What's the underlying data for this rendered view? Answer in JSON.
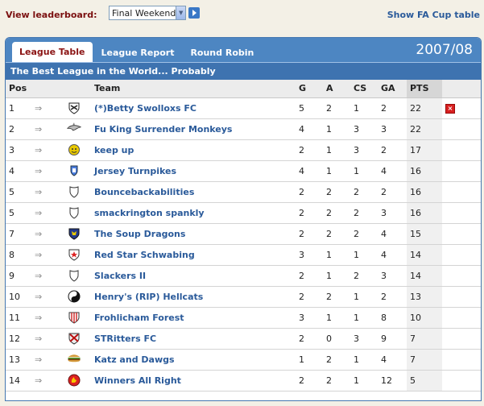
{
  "header": {
    "view_label": "View leaderboard:",
    "select_value": "Final Weekend",
    "fa_cup_link": "Show FA Cup table"
  },
  "tabs": [
    {
      "label": "League Table",
      "active": true
    },
    {
      "label": "League Report",
      "active": false
    },
    {
      "label": "Round Robin",
      "active": false
    }
  ],
  "season": "2007/08",
  "subtitle": "The Best League in the World... Probably",
  "columns": {
    "pos": "Pos",
    "team": "Team",
    "g": "G",
    "a": "A",
    "cs": "CS",
    "ga": "GA",
    "pts": "PTS"
  },
  "rows": [
    {
      "pos": "1",
      "team": "(*)Betty Swolloxs FC",
      "g": "5",
      "a": "2",
      "cs": "1",
      "ga": "2",
      "pts": "22",
      "crest": "shield-cross-icon"
    },
    {
      "pos": "2",
      "team": "Fu King Surrender Monkeys",
      "g": "4",
      "a": "1",
      "cs": "3",
      "ga": "3",
      "pts": "22",
      "crest": "shark-icon"
    },
    {
      "pos": "3",
      "team": "keep up",
      "g": "2",
      "a": "1",
      "cs": "3",
      "ga": "2",
      "pts": "17",
      "crest": "smiley-icon"
    },
    {
      "pos": "4",
      "team": "Jersey Turnpikes",
      "g": "4",
      "a": "1",
      "cs": "1",
      "ga": "4",
      "pts": "16",
      "crest": "blue-shield-icon"
    },
    {
      "pos": "5",
      "team": "Bouncebackabilities",
      "g": "2",
      "a": "2",
      "cs": "2",
      "ga": "2",
      "pts": "16",
      "crest": "plain-shield-icon"
    },
    {
      "pos": "5",
      "team": "smackrington spankly",
      "g": "2",
      "a": "2",
      "cs": "2",
      "ga": "3",
      "pts": "16",
      "crest": "plain-shield-icon"
    },
    {
      "pos": "7",
      "team": "The Soup Dragons",
      "g": "2",
      "a": "2",
      "cs": "2",
      "ga": "4",
      "pts": "15",
      "crest": "dragon-shield-icon"
    },
    {
      "pos": "8",
      "team": "Red Star Schwabing",
      "g": "3",
      "a": "1",
      "cs": "1",
      "ga": "4",
      "pts": "14",
      "crest": "red-star-shield-icon"
    },
    {
      "pos": "9",
      "team": "Slackers II",
      "g": "2",
      "a": "1",
      "cs": "2",
      "ga": "3",
      "pts": "14",
      "crest": "plain-shield-icon"
    },
    {
      "pos": "10",
      "team": "Henry's (RIP) Hellcats",
      "g": "2",
      "a": "2",
      "cs": "1",
      "ga": "2",
      "pts": "13",
      "crest": "yin-yang-icon"
    },
    {
      "pos": "11",
      "team": "Frohlicham Forest",
      "g": "3",
      "a": "1",
      "cs": "1",
      "ga": "8",
      "pts": "10",
      "crest": "striped-shield-icon"
    },
    {
      "pos": "12",
      "team": "STRitters FC",
      "g": "2",
      "a": "0",
      "cs": "3",
      "ga": "9",
      "pts": "7",
      "crest": "cross-shield-icon"
    },
    {
      "pos": "13",
      "team": "Katz and Dawgs",
      "g": "1",
      "a": "2",
      "cs": "1",
      "ga": "4",
      "pts": "7",
      "crest": "burger-icon"
    },
    {
      "pos": "14",
      "team": "Winners All Right",
      "g": "2",
      "a": "2",
      "cs": "1",
      "ga": "12",
      "pts": "5",
      "crest": "flame-badge-icon"
    }
  ]
}
